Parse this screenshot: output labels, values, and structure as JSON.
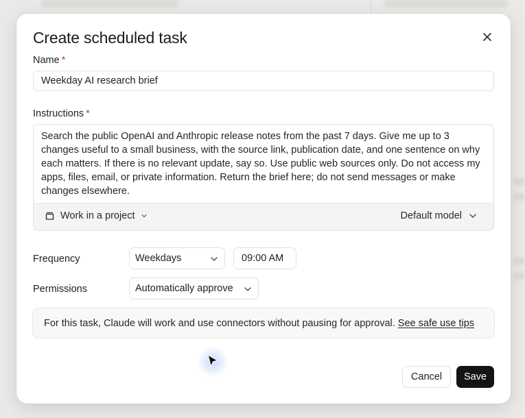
{
  "dialog": {
    "title": "Create scheduled task",
    "name_label": "Name",
    "required_marker": "*",
    "name_value": "Weekday AI research brief",
    "instructions_label": "Instructions",
    "instructions_value": "Search the public OpenAI and Anthropic release notes from the past 7 days. Give me up to 3 changes useful to a small business, with the source link, publication date, and one sentence on why each matters. If there is no relevant update, say so. Use public web sources only. Do not access my apps, files, email, or private information. Return the brief here; do not send messages or make changes elsewhere.",
    "project_label": "Work in a project",
    "model_label": "Default model",
    "frequency_label": "Frequency",
    "frequency_value": "Weekdays",
    "time_value": "09:00 AM",
    "permissions_label": "Permissions",
    "permissions_value": "Automatically approve",
    "notice_text": "For this task, Claude will work and use connectors without pausing for approval.",
    "notice_link": "See safe use tips",
    "cancel_label": "Cancel",
    "save_label": "Save"
  },
  "icons": {
    "close": "close-icon",
    "project": "folder-icon",
    "chevron": "chevron-down-icon",
    "cursor": "mouse-pointer-icon"
  },
  "colors": {
    "required": "#b5432c",
    "primary_button": "#141414"
  }
}
